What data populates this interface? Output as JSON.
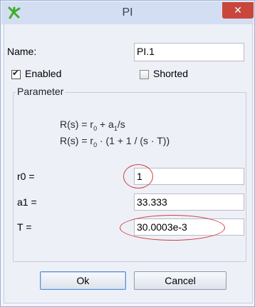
{
  "window": {
    "title": "PI",
    "close_glyph": "✕",
    "icon": "green-leaf-icon",
    "title_color": "#d4def2",
    "close_color": "#c9463d"
  },
  "form": {
    "name_label": "Name:",
    "name_value": "PI.1",
    "enabled_label": "Enabled",
    "enabled_checked": true,
    "shorted_label": "Shorted",
    "shorted_checked": false
  },
  "parameter": {
    "group_title": "Parameter",
    "formula1": {
      "a": "R(s) = r",
      "a_sub": "0",
      "b": " + a",
      "b_sub": "1",
      "c": "/s"
    },
    "formula2": {
      "a": "R(s) = r",
      "a_sub": "0",
      "b": " · (1 + 1 / (s · T))"
    },
    "fields": [
      {
        "label": "r0 =",
        "value": "1"
      },
      {
        "label": "a1 =",
        "value": "33.333"
      },
      {
        "label": "T =",
        "value": "30.0003e-3"
      }
    ],
    "highlight_color": "#d23c3c"
  },
  "buttons": {
    "ok_label": "Ok",
    "cancel_label": "Cancel"
  }
}
